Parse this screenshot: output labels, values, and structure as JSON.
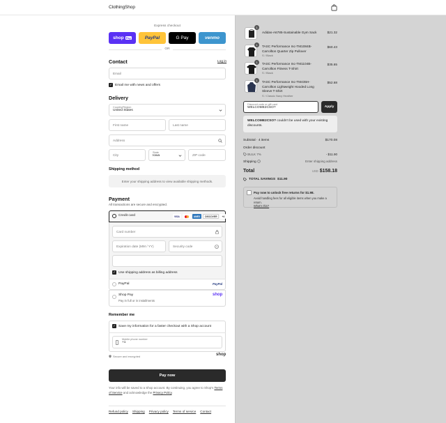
{
  "header": {
    "logo": "ClothingShop",
    "bag_icon": "shopping-bag-icon"
  },
  "express": {
    "title": "Express checkout",
    "buttons": [
      {
        "label": "shop",
        "sub": "Pay",
        "color": "#5a31f4"
      },
      {
        "label": "PayPal",
        "color": "#ffc439"
      },
      {
        "label": "G Pay",
        "color": "#000000"
      },
      {
        "label": "venmo",
        "color": "#3d95ce"
      }
    ],
    "or": "OR"
  },
  "contact": {
    "title": "Contact",
    "login": "Log in",
    "email_placeholder": "Email",
    "email_news": "Email me with news and offers"
  },
  "delivery": {
    "title": "Delivery",
    "country_label": "Country/Region",
    "country_value": "United States",
    "first_name": "First name",
    "last_name": "Last name",
    "address": "Address",
    "city": "City",
    "state_label": "State",
    "state_value": "Iowa",
    "zip": "ZIP code"
  },
  "shipping": {
    "title": "Shipping method",
    "note": "Enter your shipping address to view available shipping methods."
  },
  "payment": {
    "title": "Payment",
    "subtitle": "All transactions are secure and encrypted.",
    "credit_card": "Credit card",
    "card_logos": [
      "VISA",
      "MC",
      "AMEX",
      "DISCOVER",
      "+4"
    ],
    "card_number": "Card number",
    "expiration": "Expiration date (MM / YY)",
    "security": "Security code",
    "name_on_card": "",
    "billing_same": "Use shipping address as billing address",
    "paypal": "PayPal",
    "paypal_logo": "PayPal",
    "shop_pay": "Shop Pay",
    "shop_pay_sub": "Pay in full or in installments",
    "shop_logo": "shop"
  },
  "remember": {
    "title": "Remember me",
    "save_info": "Save my information for a faster checkout with a Shop account",
    "phone_label": "Mobile phone number",
    "phone_value": "+1",
    "secure": "Secure and encrypted",
    "shop_logo": "shop"
  },
  "pay_now": "Pay now",
  "disclaimer": {
    "prefix": "Your info will be saved to a Shop account. By continuing, you agree to Shop's",
    "terms": "Terms of Service",
    "middle": "and acknowledge the",
    "privacy": "Privacy Policy",
    "end": "."
  },
  "footer_links": [
    "Refund policy",
    "Shipping",
    "Privacy policy",
    "Terms of service",
    "Contact"
  ],
  "cart": {
    "items": [
      {
        "qty": "1",
        "name": "Adidas-A6785-Sustainable Gym Sack",
        "variant": "",
        "price": "$21.32"
      },
      {
        "qty": "1",
        "name": "TASC Performance Inc-TM1084B-Carrollton Quarter Zip Pullover",
        "variant": "S / Black",
        "price": "$60.43"
      },
      {
        "qty": "1",
        "name": "TASC Performance Inc-TM1104B-Carrollton Fitness T-Shirt",
        "variant": "S / Black",
        "price": "$35.65"
      },
      {
        "qty": "1",
        "name": "TASC Performance Inc-TM435H-Carrollton Lightweight Hooded Long Sleeve T-Shirt",
        "variant": "S / Classic Navy Heather",
        "price": "$52.68"
      }
    ],
    "discount_label": "Discount code or gift card",
    "discount_value": "WELCOME2CSO?",
    "apply": "Apply",
    "error_code": "WELCOME2CSO?",
    "error_text": "couldn't be used with your existing discounts.",
    "subtotal_label": "Subtotal · 4 items",
    "subtotal_value": "$170.08",
    "order_discount": "Order discount",
    "bulk_label": "BULK 7%",
    "bulk_value": "- $11.90",
    "shipping_label": "Shipping",
    "shipping_value": "Enter shipping address",
    "total_label": "Total",
    "currency": "USD",
    "total_value": "$158.18",
    "savings_label": "TOTAL SAVINGS",
    "savings_value": "$11.90",
    "returns_title": "Pay now to unlock free returns for $1.98.",
    "returns_text": "Avoid handling fees for all eligible items when you make a return.",
    "returns_link": "What's this?"
  }
}
